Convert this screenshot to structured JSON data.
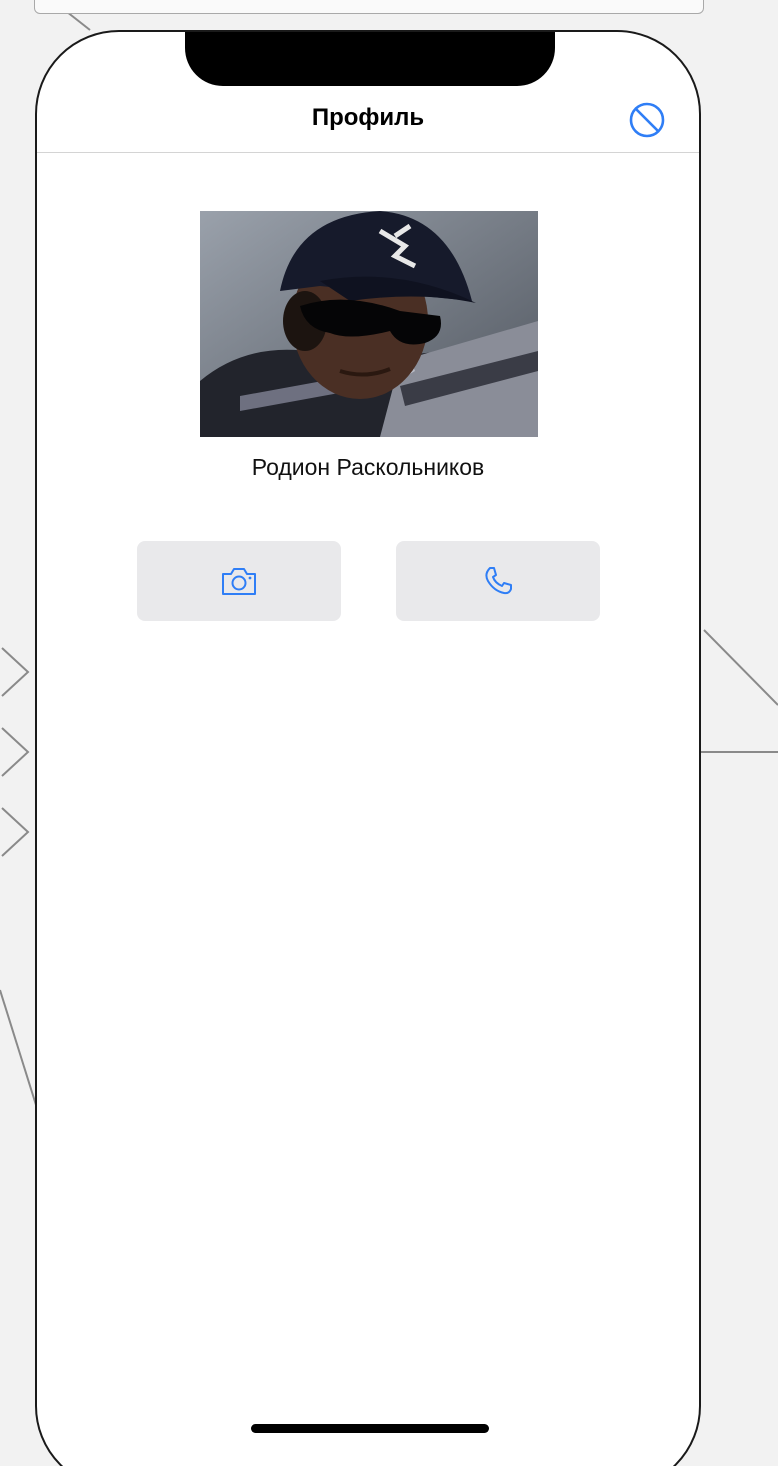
{
  "nav": {
    "title": "Профиль",
    "right_icon": "block-icon"
  },
  "profile": {
    "name": "Родион Раскольников",
    "photo": "profile-photo"
  },
  "actions": [
    {
      "icon": "camera-icon",
      "color": "#2f7ef6"
    },
    {
      "icon": "phone-icon",
      "color": "#2f7ef6"
    }
  ],
  "colors": {
    "accent": "#2f7ef6",
    "button_bg": "#e9e9eb",
    "divider": "#d4d4d4"
  }
}
